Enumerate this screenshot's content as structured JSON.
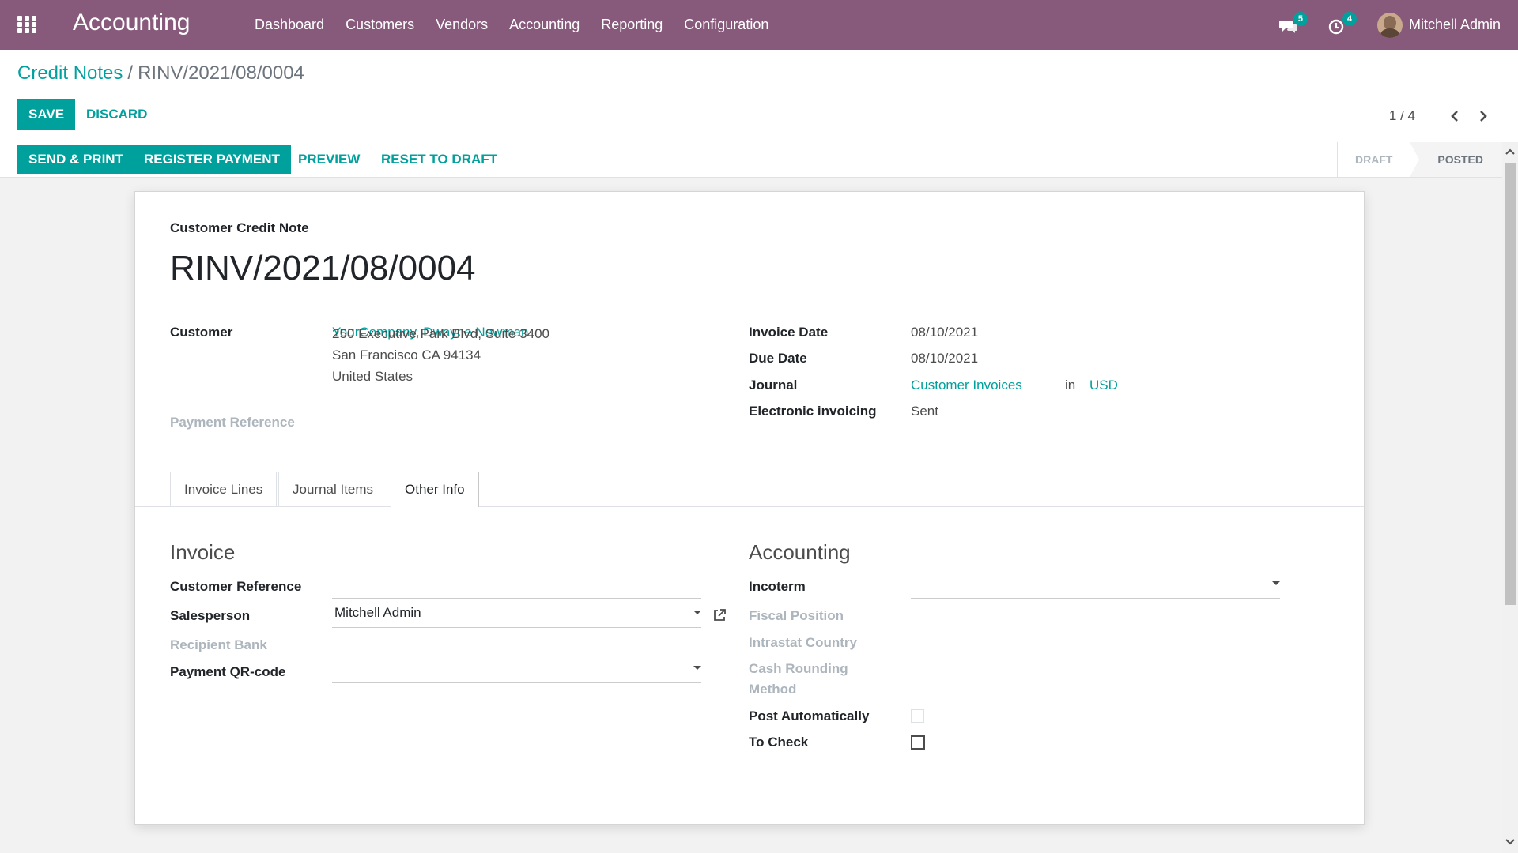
{
  "topnav": {
    "app_title": "Accounting",
    "menu": [
      "Dashboard",
      "Customers",
      "Vendors",
      "Accounting",
      "Reporting",
      "Configuration"
    ],
    "messages_count": "5",
    "activities_count": "4",
    "user_name": "Mitchell Admin"
  },
  "breadcrumb": {
    "parent": "Credit Notes",
    "current": "RINV/2021/08/0004"
  },
  "actions": {
    "save": "Save",
    "discard": "Discard"
  },
  "pager": {
    "value": "1 / 4"
  },
  "statusbar": {
    "send_print": "Send & Print",
    "register_payment": "Register Payment",
    "preview": "Preview",
    "reset_to_draft": "Reset to Draft",
    "steps": [
      "Draft",
      "Posted"
    ],
    "active_step": "Posted"
  },
  "document": {
    "type": "Customer Credit Note",
    "name": "RINV/2021/08/0004"
  },
  "fields": {
    "customer_label": "Customer",
    "customer_name": "YourCompany, Dwayne Newman",
    "address_line1": "250 Executive Park Blvd, Suite 3400",
    "address_line2": "San Francisco CA 94134",
    "address_line3": "United States",
    "payment_reference_label": "Payment Reference",
    "invoice_date_label": "Invoice Date",
    "invoice_date": "08/10/2021",
    "due_date_label": "Due Date",
    "due_date": "08/10/2021",
    "journal_label": "Journal",
    "journal": "Customer Invoices",
    "journal_in": "in",
    "currency": "USD",
    "einvoicing_label": "Electronic invoicing",
    "einvoicing": "Sent"
  },
  "tabs": [
    "Invoice Lines",
    "Journal Items",
    "Other Info"
  ],
  "active_tab": "Other Info",
  "other_info": {
    "invoice_title": "Invoice",
    "customer_reference_label": "Customer Reference",
    "customer_reference": "",
    "salesperson_label": "Salesperson",
    "salesperson": "Mitchell Admin",
    "recipient_bank_label": "Recipient Bank",
    "payment_qr_label": "Payment QR-code",
    "payment_qr": "",
    "accounting_title": "Accounting",
    "incoterm_label": "Incoterm",
    "incoterm": "",
    "fiscal_position_label": "Fiscal Position",
    "intrastat_country_label": "Intrastat Country",
    "cash_rounding_label_1": "Cash Rounding",
    "cash_rounding_label_2": "Method",
    "post_automatically_label": "Post Automatically",
    "post_automatically": false,
    "to_check_label": "To Check",
    "to_check": false
  },
  "colors": {
    "brand": "#875a7b",
    "accent": "#00a09d"
  }
}
